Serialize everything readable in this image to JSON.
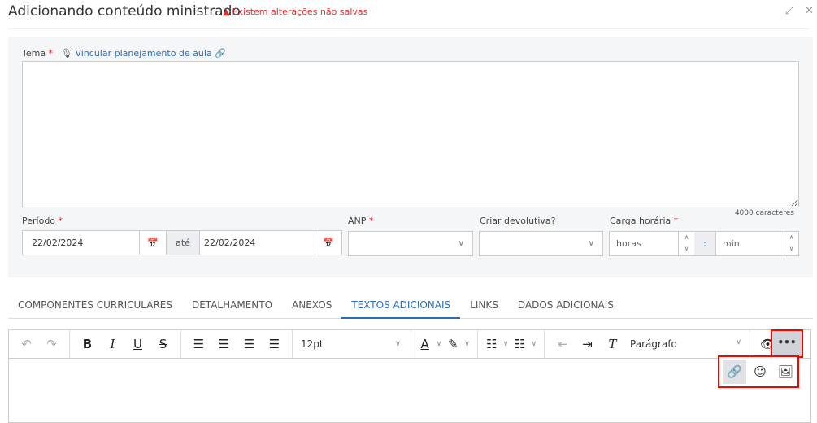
{
  "header": {
    "title": "Adicionando conteúdo ministrado",
    "warning": "Existem alterações não salvas"
  },
  "form": {
    "tema_label": "Tema",
    "link_label": "Vincular planejamento de aula",
    "counter": "4000 caracteres",
    "periodo_label": "Período",
    "date_start": "22/02/2024",
    "ate": "até",
    "date_end": "22/02/2024",
    "anp_label": "ANP",
    "devolutiva_label": "Criar devolutiva?",
    "carga_label": "Carga horária",
    "horas_placeholder": "horas",
    "sep": ":",
    "min_placeholder": "min."
  },
  "tabs": [
    {
      "label": "COMPONENTES CURRICULARES"
    },
    {
      "label": "DETALHAMENTO"
    },
    {
      "label": "ANEXOS"
    },
    {
      "label": "TEXTOS ADICIONAIS",
      "active": true
    },
    {
      "label": "LINKS"
    },
    {
      "label": "DADOS ADICIONAIS"
    }
  ],
  "toolbar": {
    "font_size": "12pt",
    "block_format": "Parágrafo",
    "more": "•••"
  },
  "colors": {
    "accent": "#2a6ebb",
    "warning": "#e0302e",
    "highlight": "#ff0000"
  }
}
